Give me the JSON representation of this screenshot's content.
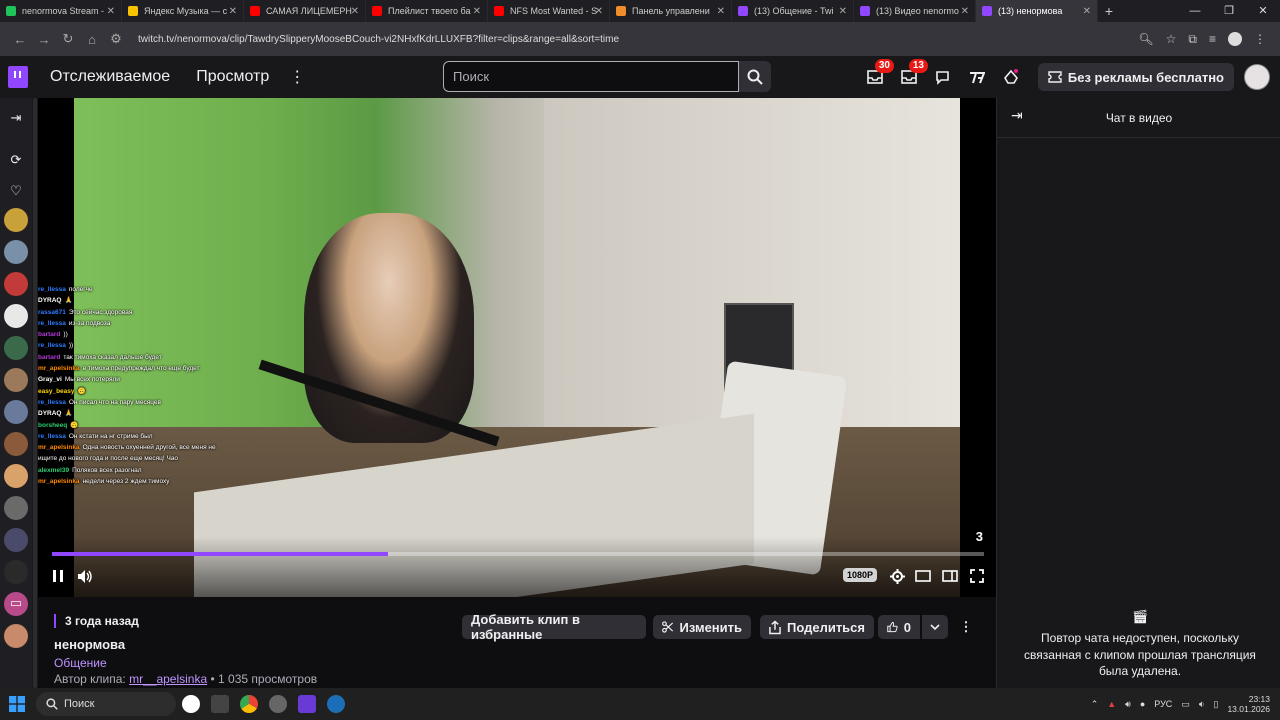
{
  "browser": {
    "tabs": [
      {
        "title": "nenormova Stream -",
        "color": "#20c25a"
      },
      {
        "title": "Яндекс Музыка — с",
        "color": "#f8c300"
      },
      {
        "title": "САМАЯ ЛИЦЕМЕРН",
        "color": "#ff0000"
      },
      {
        "title": "Плейлист твоего ба",
        "color": "#ff0000"
      },
      {
        "title": "NFS Most Wanted - S",
        "color": "#ff0000"
      },
      {
        "title": "Панель управлени",
        "color": "#f08c2a"
      },
      {
        "title": "(13) Общение - Twi",
        "color": "#9147ff"
      },
      {
        "title": "(13) Видео nenormo",
        "color": "#9147ff"
      },
      {
        "title": "(13) ненормова",
        "color": "#9147ff"
      }
    ],
    "url": "twitch.tv/nenormova/clip/TawdrySlipperyMooseBCouch-vi2NHxfKdrLLUXFB?filter=clips&range=all&sort=time"
  },
  "header": {
    "following": "Отслеживаемое",
    "browse": "Просмотр",
    "search_placeholder": "Поиск",
    "inbox_count": "30",
    "whispers_count": "13",
    "ad_free_label": "Без рекламы бесплатно"
  },
  "left_rail": {
    "avatar_colors": [
      "#c9a13a",
      "#7a8fa8",
      "#c23a3a",
      "#e8e8e8",
      "#3a6a4a",
      "#9a7a5a",
      "#6a7a9a",
      "#8a5a3a",
      "#d8a26a",
      "#6a6a6a",
      "#4a4a6a",
      "#2a2a2a",
      "#b84a8a",
      "#c88a6a"
    ]
  },
  "overlay_chat": [
    {
      "user": "re_llessa",
      "color": "#2e7bff",
      "text": "полегче"
    },
    {
      "user": "DYRAQ",
      "color": "#ffffff",
      "text": "🙏"
    },
    {
      "user": "rassa671",
      "color": "#2e7bff",
      "text": "Это сейчас здоровая"
    },
    {
      "user": "re_llessa",
      "color": "#2e7bff",
      "text": "из-за подвоза"
    },
    {
      "user": "bartard",
      "color": "#b23ad6",
      "text": "))"
    },
    {
      "user": "re_llessa",
      "color": "#2e7bff",
      "text": "))"
    },
    {
      "user": "bartard",
      "color": "#b23ad6",
      "text": "так тимоха сказал дальше будет"
    },
    {
      "user": "mr_apelsinka",
      "color": "#ff8a00",
      "text": "в тимоха предупреждал что еще будет"
    },
    {
      "user": "Gray_vi",
      "color": "#ffffff",
      "text": "Мы всех потеряли"
    },
    {
      "user": "easy_beasy",
      "color": "#ffd400",
      "text": "🙃"
    },
    {
      "user": "re_llessa",
      "color": "#2e7bff",
      "text": "Он писал что на пару месяцев"
    },
    {
      "user": "DYRAQ",
      "color": "#ffffff",
      "text": "🙏"
    },
    {
      "user": "borsheeq",
      "color": "#2ecc71",
      "text": "🙃"
    },
    {
      "user": "re_llessa",
      "color": "#2e7bff",
      "text": "Он кстати на нг стриме был"
    },
    {
      "user": "mr_apelsinka",
      "color": "#ff8a00",
      "text": "Одна новость охуенней другой, все меня не"
    },
    {
      "user": "",
      "color": "#ffffff",
      "text": "ищите до нового года и после еще месяц! Чао"
    },
    {
      "user": "alexmel39",
      "color": "#2ecc71",
      "text": "Поляков всех разогнал"
    },
    {
      "user": "mr_apelsinka",
      "color": "#ff8a00",
      "text": "недели через 2 ждем тимоху"
    }
  ],
  "player": {
    "clip_counter": "3",
    "progress": 0.36,
    "quality": "1080P"
  },
  "clip_info": {
    "time_ago": "3 года назад",
    "channel": "ненормова",
    "category": "Общение",
    "author_prefix": "Автор клипа:",
    "author": "mr__apelsinka",
    "views": "• 1 035 просмотров",
    "favorite_label": "Добавить клип в избранные",
    "edit_label": "Изменить",
    "share_label": "Поделиться",
    "like_count": "0"
  },
  "chat_panel": {
    "title": "Чат в видео",
    "unavailable_message": "Повтор чата недоступен, поскольку связанная с клипом прошлая трансляция была удалена."
  },
  "taskbar": {
    "search_label": "Поиск",
    "lang": "РУС",
    "time": "23:13",
    "date": "13.01.2026"
  },
  "colors": {
    "accent": "#9147ff",
    "accent_text": "#bf94ff",
    "badge": "#e91916"
  }
}
